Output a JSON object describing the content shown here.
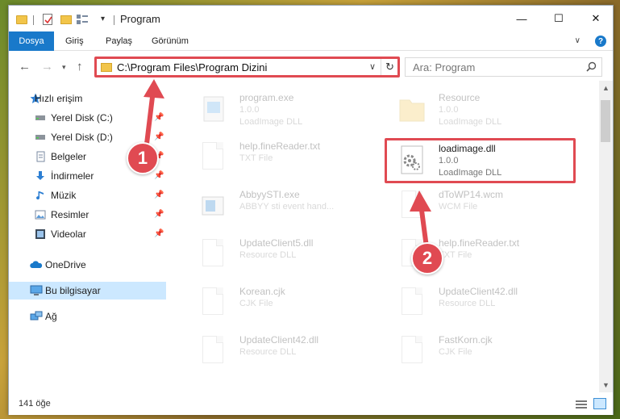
{
  "window": {
    "title": "Program",
    "minimize_glyph": "—",
    "maximize_glyph": "☐",
    "close_glyph": "✕"
  },
  "ribbon": {
    "file_tab": "Dosya",
    "tabs": [
      "Giriş",
      "Paylaş",
      "Görünüm"
    ],
    "help_glyph": "?"
  },
  "navbar": {
    "address": "C:\\Program Files\\Program Dizini",
    "search_placeholder": "Ara: Program"
  },
  "sidebar": {
    "items": [
      {
        "label": "Hızlı erişim",
        "icon": "star-icon"
      },
      {
        "label": "Yerel Disk (C:)",
        "icon": "drive-icon",
        "pinned": true
      },
      {
        "label": "Yerel Disk (D:)",
        "icon": "drive-icon",
        "pinned": true
      },
      {
        "label": "Belgeler",
        "icon": "documents-icon",
        "pinned": true
      },
      {
        "label": "İndirmeler",
        "icon": "download-icon",
        "pinned": true
      },
      {
        "label": "Müzik",
        "icon": "music-icon",
        "pinned": true
      },
      {
        "label": "Resimler",
        "icon": "pictures-icon",
        "pinned": true
      },
      {
        "label": "Videolar",
        "icon": "videos-icon",
        "pinned": true
      },
      {
        "label": "OneDrive",
        "icon": "onedrive-icon"
      },
      {
        "label": "Bu bilgisayar",
        "icon": "computer-icon",
        "selected": true
      },
      {
        "label": "Ağ",
        "icon": "network-icon"
      }
    ]
  },
  "files": [
    {
      "name": "program.exe",
      "line1": "1.0.0",
      "line2": "LoadImage DLL",
      "icon": "exe-icon",
      "highlighted": false
    },
    {
      "name": "Resource",
      "line1": "1.0.0",
      "line2": "LoadImage DLL",
      "icon": "folder-icon",
      "highlighted": false
    },
    {
      "name": "help.fineReader.txt",
      "line1": "TXT File",
      "line2": "",
      "icon": "document-icon",
      "highlighted": false
    },
    {
      "name": "loadimage.dll",
      "line1": "1.0.0",
      "line2": "LoadImage DLL",
      "icon": "dll-gear-icon",
      "highlighted": true
    },
    {
      "name": "AbbyySTI.exe",
      "line1": "ABBYY sti event hand...",
      "line2": "",
      "icon": "exe-window-icon",
      "highlighted": false
    },
    {
      "name": "dToWP14.wcm",
      "line1": "WCM File",
      "line2": "",
      "icon": "document-icon",
      "highlighted": false
    },
    {
      "name": "UpdateClient5.dll",
      "line1": "Resource DLL",
      "line2": "",
      "icon": "dll-gear-icon",
      "highlighted": false
    },
    {
      "name": "help.fineReader.txt",
      "line1": "TXT File",
      "line2": "",
      "icon": "document-icon",
      "highlighted": false
    },
    {
      "name": "Korean.cjk",
      "line1": "CJK File",
      "line2": "",
      "icon": "document-icon",
      "highlighted": false
    },
    {
      "name": "UpdateClient42.dll",
      "line1": "Resource DLL",
      "line2": "",
      "icon": "dll-gear-icon",
      "highlighted": false
    },
    {
      "name": "UpdateClient42.dll",
      "line1": "Resource DLL",
      "line2": "",
      "icon": "dll-gear-icon",
      "highlighted": false
    },
    {
      "name": "FastKorn.cjk",
      "line1": "CJK File",
      "line2": "",
      "icon": "document-icon",
      "highlighted": false
    }
  ],
  "status": {
    "item_count": "141 öğe"
  },
  "callouts": [
    {
      "number": "1"
    },
    {
      "number": "2"
    }
  ],
  "colors": {
    "accent": "#1979ca",
    "highlight": "#e04a52",
    "selected": "#cce8ff"
  }
}
